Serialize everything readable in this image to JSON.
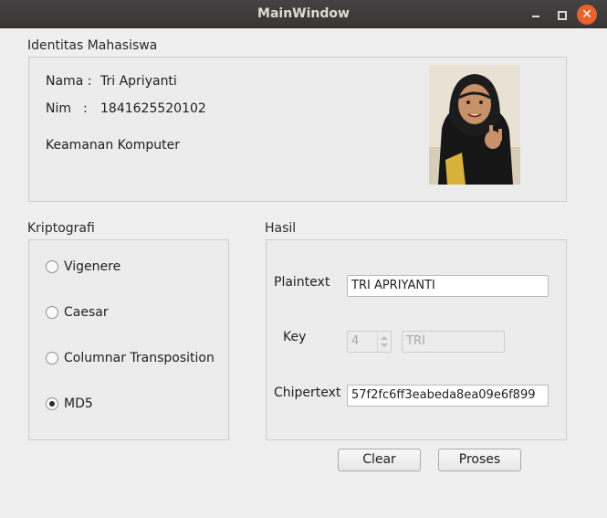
{
  "window": {
    "title": "MainWindow"
  },
  "identity": {
    "group_title": "Identitas Mahasiswa",
    "name_label": "Nama :",
    "name_value": "Tri Apriyanti",
    "nim_label": "Nim",
    "nim_colon": ":",
    "nim_value": "1841625520102",
    "course": "Keamanan Komputer"
  },
  "crypto": {
    "group_title": "Kriptografi",
    "options": [
      {
        "label": "Vigenere",
        "checked": false
      },
      {
        "label": "Caesar",
        "checked": false
      },
      {
        "label": "Columnar Transposition",
        "checked": false
      },
      {
        "label": "MD5",
        "checked": true
      }
    ]
  },
  "result": {
    "group_title": "Hasil",
    "plaintext_label": "Plaintext",
    "plaintext_value": "TRI APRIYANTI",
    "key_label": "Key",
    "key_number": "4",
    "key_text": "TRI",
    "ciphertext_label": "Chipertext",
    "ciphertext_value": "57f2fc6ff3eabeda8ea09e6f899"
  },
  "buttons": {
    "clear": "Clear",
    "process": "Proses"
  }
}
